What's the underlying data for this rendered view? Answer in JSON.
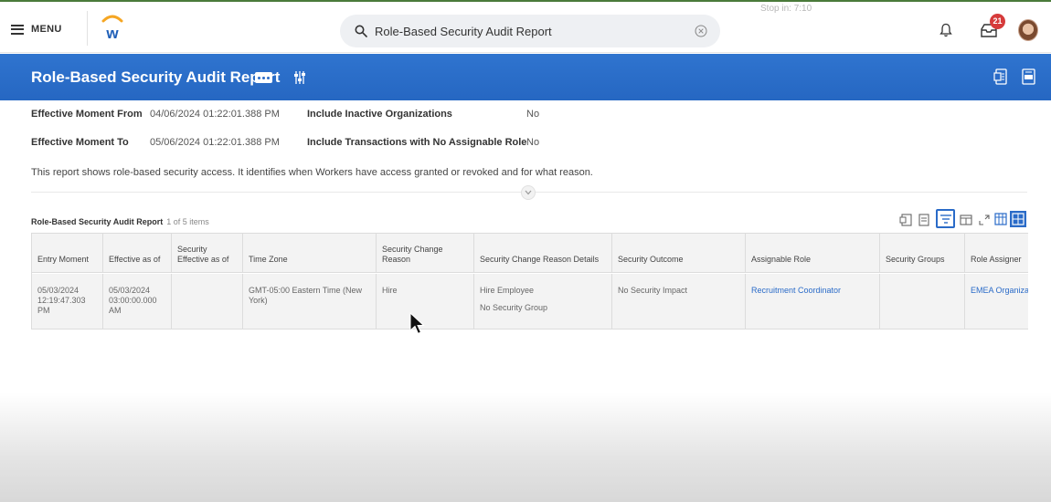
{
  "topbar": {
    "menu_label": "MENU",
    "search_value": "Role-Based Security Audit Report",
    "timer_text": "Stop in: 7:10",
    "notification_count": "21"
  },
  "header": {
    "title": "Role-Based Security Audit Report"
  },
  "params": [
    {
      "label": "Effective Moment From",
      "value": "04/06/2024 01:22:01.388 PM"
    },
    {
      "label": "Effective Moment To",
      "value": "05/06/2024 01:22:01.388 PM"
    },
    {
      "label": "Include Inactive Organizations",
      "value": "No"
    },
    {
      "label": "Include Transactions with No Assignable Role",
      "value": "No"
    }
  ],
  "description": "This report shows role-based security access. It identifies when Workers have access granted or revoked and for what reason.",
  "grid": {
    "title": "Role-Based Security Audit Report",
    "count": "1 of 5 items",
    "columns": [
      "Entry Moment",
      "Effective as of",
      "Security Effective as of",
      "Time Zone",
      "Security Change Reason",
      "Security Change Reason Details",
      "Security Outcome",
      "Assignable Role",
      "Security Groups",
      "Role Assigner"
    ],
    "row": {
      "entry_moment": "05/03/2024 12:19:47.303 PM",
      "effective_as_of": "05/03/2024 03:00:00.000 AM",
      "security_effective_as_of": "",
      "time_zone": "GMT-05:00 Eastern Time (New York)",
      "change_reason": "Hire",
      "reason_details_1": "Hire Employee",
      "reason_details_2": "No Security Group",
      "security_outcome": "No Security Impact",
      "assignable_role": "Recruitment Coordinator",
      "security_groups": "",
      "role_assigner": "EMEA Organiza"
    }
  },
  "colors": {
    "brand_blue": "#2a6bc8",
    "badge_red": "#d63b3b"
  }
}
